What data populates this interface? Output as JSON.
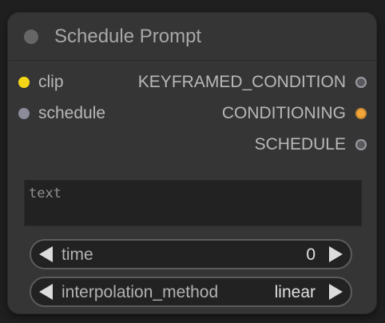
{
  "node": {
    "title": "Schedule Prompt",
    "inputs": [
      {
        "label": "clip",
        "color": "#f5d718"
      },
      {
        "label": "schedule",
        "color": "#8b8b99"
      }
    ],
    "outputs": [
      {
        "label": "KEYFRAMED_CONDITION",
        "color": "#7a7a80"
      },
      {
        "label": "CONDITIONING",
        "color": "#f5a63a"
      },
      {
        "label": "SCHEDULE",
        "color": "#7a7a80"
      }
    ],
    "text_widget": {
      "placeholder": "text"
    },
    "widgets": [
      {
        "label": "time",
        "value": "0"
      },
      {
        "label": "interpolation_method",
        "value": "linear"
      }
    ]
  }
}
